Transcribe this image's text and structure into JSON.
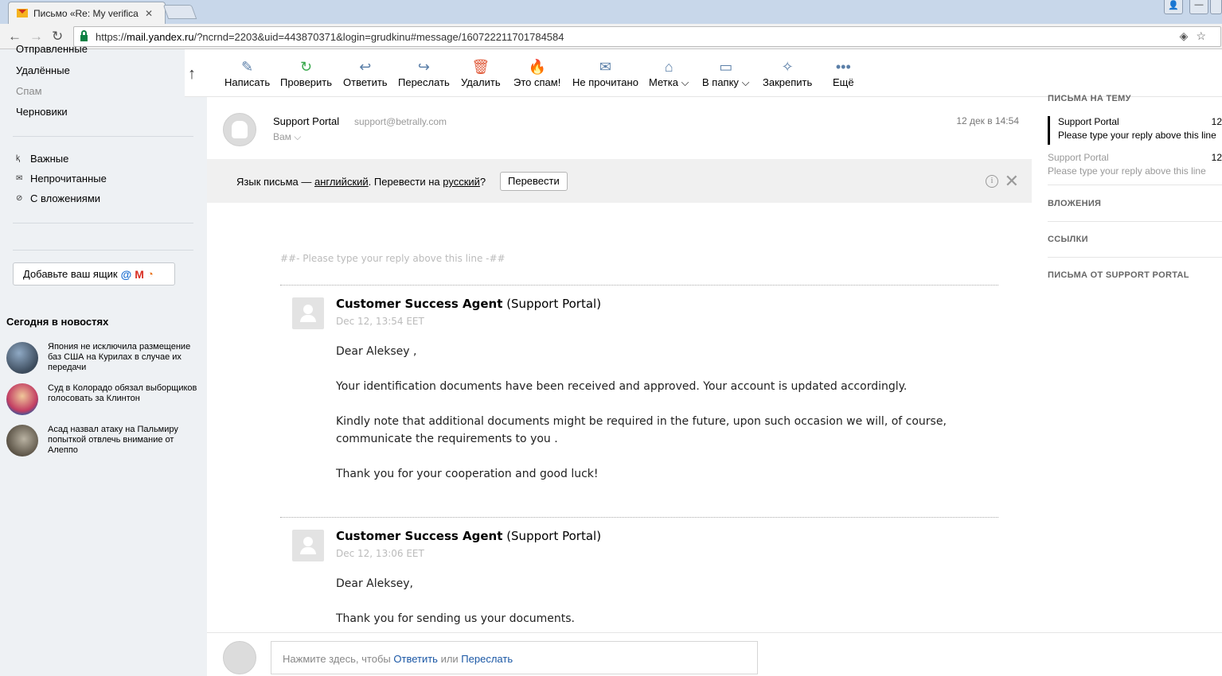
{
  "browser": {
    "tab_title": "Письмо «Re: My verificat",
    "tab_close": "✕",
    "url_prefix": "https://",
    "url_host": "mail.yandex.ru",
    "url_rest": "/?ncrnd=2203&uid=443870371&login=grudkinu#message/160722211701784584"
  },
  "sidebar": {
    "folders": [
      {
        "label": "Отправленные",
        "muted": false
      },
      {
        "label": "Удалённые",
        "muted": false
      },
      {
        "label": "Спам",
        "muted": true
      },
      {
        "label": "Черновики",
        "muted": false
      }
    ],
    "filters": [
      {
        "label": "Важные",
        "icon": "important-icon"
      },
      {
        "label": "Непрочитанные",
        "icon": "unread-icon"
      },
      {
        "label": "С вложениями",
        "icon": "attachment-icon"
      }
    ],
    "add_mailbox_label": "Добавьте ваш ящик",
    "news_title": "Сегодня в новостях",
    "news": [
      "Япония не исключила размещение баз США на Курилах в случае их передачи",
      "Суд в Колорадо обязал выборщиков голосовать за Клинтон",
      "Асад назвал атаку на Пальмиру попыткой отвлечь внимание от Алеппо"
    ]
  },
  "toolbar": {
    "items": [
      {
        "label": "Написать",
        "icon": "compose-icon"
      },
      {
        "label": "Проверить",
        "icon": "refresh-icon"
      },
      {
        "label": "Ответить",
        "icon": "reply-icon"
      },
      {
        "label": "Переслать",
        "icon": "forward-icon"
      },
      {
        "label": "Удалить",
        "icon": "trash-icon"
      },
      {
        "label": "Это спам!",
        "icon": "spam-fire-icon"
      },
      {
        "label": "Не прочитано",
        "icon": "envelope-icon"
      },
      {
        "label": "Метка",
        "icon": "label-icon"
      },
      {
        "label": "В папку",
        "icon": "folder-icon"
      },
      {
        "label": "Закрепить",
        "icon": "pin-icon"
      },
      {
        "label": "Ещё",
        "icon": "more-icon"
      }
    ]
  },
  "message": {
    "from_name": "Support Portal",
    "from_email": "support@betrally.com",
    "to": "Вам",
    "date": "12 дек в 14:54"
  },
  "translate": {
    "prefix": "Язык письма — ",
    "lang_from": "английский",
    "middle": ". Перевести на ",
    "lang_to": "русский",
    "suffix": "?",
    "button": "Перевести"
  },
  "body": {
    "reply_marker": "##- Please type your reply above this line -##",
    "entries": [
      {
        "agent": "Customer Success Agent",
        "org": "(Support Portal)",
        "date": "Dec 12, 13:54 EET",
        "paragraphs": [
          "Dear Aleksey ,",
          "Your identification documents have been received and approved. Your account is updated accordingly.",
          "Kindly note that additional documents might be required in the future, upon such occasion we will, of course, communicate the requirements to you .",
          "Thank you for your cooperation and good luck!"
        ]
      },
      {
        "agent": "Customer Success Agent",
        "org": "(Support Portal)",
        "date": "Dec 12, 13:06 EET",
        "paragraphs": [
          "Dear Aleksey,",
          "Thank you for sending us your documents."
        ]
      }
    ]
  },
  "right_panel": {
    "thread_heading": "ПИСЬМА НА ТЕМУ",
    "threads": [
      {
        "sender": "Support Portal",
        "subject": "Please type your reply above this line",
        "date": "12",
        "active": true
      },
      {
        "sender": "Support Portal",
        "subject": "Please type your reply above this line",
        "date": "12",
        "active": false
      }
    ],
    "sections": [
      "ВЛОЖЕНИЯ",
      "ССЫЛКИ",
      "ПИСЬМА ОТ SUPPORT PORTAL"
    ]
  },
  "quick_reply": {
    "prefix": "Нажмите здесь, чтобы ",
    "reply_link": "Ответить",
    "or": " или ",
    "forward_link": "Переслать"
  }
}
